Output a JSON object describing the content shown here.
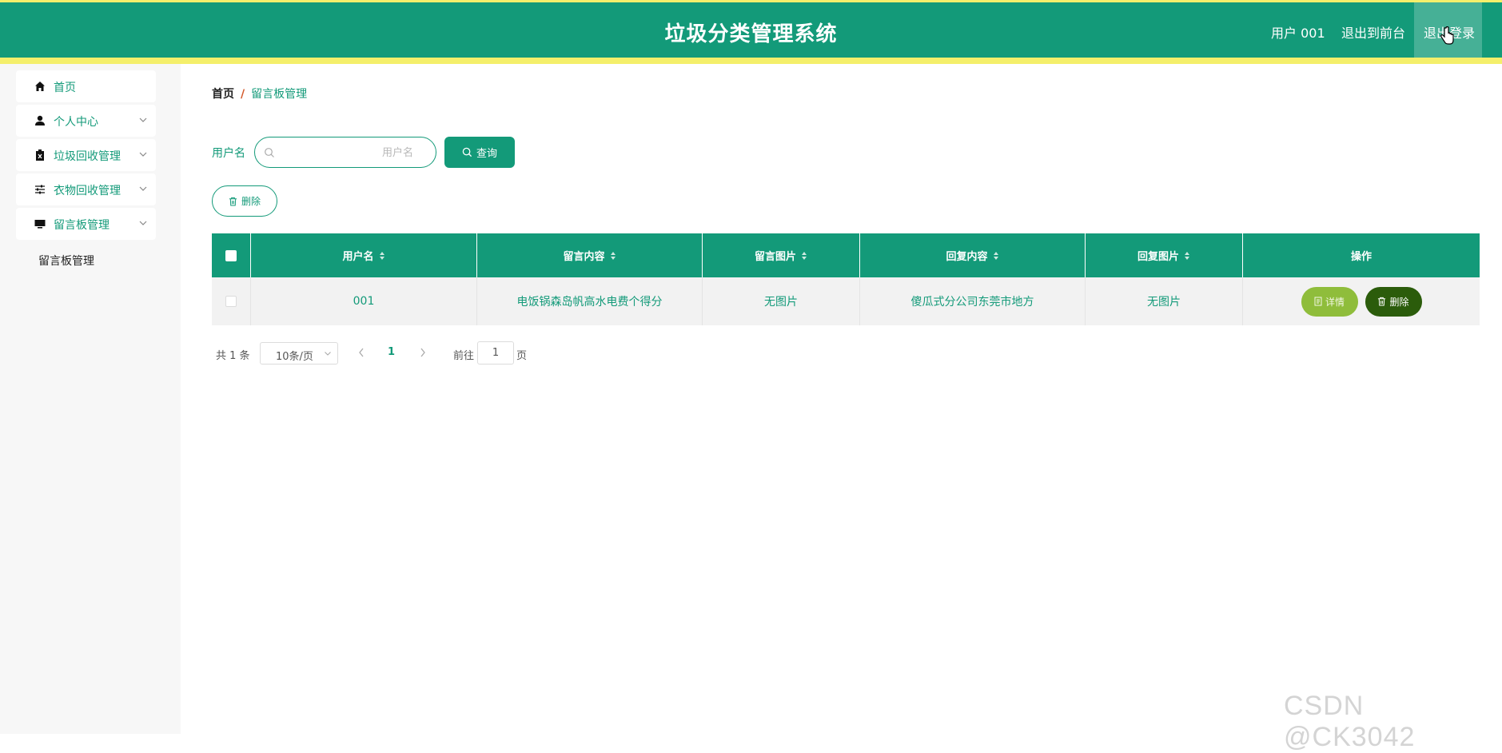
{
  "header": {
    "title": "垃圾分类管理系统",
    "user": "用户 001",
    "to_front": "退出到前台",
    "logout": "退出登录"
  },
  "sidebar": {
    "items": [
      {
        "label": "首页",
        "icon": "home-icon"
      },
      {
        "label": "个人中心",
        "icon": "user-icon"
      },
      {
        "label": "垃圾回收管理",
        "icon": "trash-icon"
      },
      {
        "label": "衣物回收管理",
        "icon": "sliders-icon"
      },
      {
        "label": "留言板管理",
        "icon": "monitor-icon"
      }
    ],
    "sub_item": "留言板管理"
  },
  "breadcrumb": {
    "home": "首页",
    "separator": "/",
    "current": "留言板管理"
  },
  "search": {
    "label": "用户名",
    "placeholder": "用户名",
    "value": "",
    "button": "查询"
  },
  "toolbar": {
    "delete_label": "删除"
  },
  "table": {
    "columns": [
      "用户名",
      "留言内容",
      "留言图片",
      "回复内容",
      "回复图片",
      "操作"
    ],
    "rows": [
      {
        "username": "001",
        "content": "电饭锅森岛帆高水电费个得分",
        "image": "无图片",
        "reply": "傻瓜式分公司东莞市地方",
        "reply_image": "无图片",
        "detail": "详情",
        "delete": "删除"
      }
    ]
  },
  "pagination": {
    "total": "共 1 条",
    "page_size": "10条/页",
    "current_page": "1",
    "goto_label": "前往",
    "goto_value": "1",
    "page_suffix": "页"
  },
  "watermark": "CSDN @CK3042",
  "colors": {
    "primary": "#139a79",
    "accent_stripe": "#f4ef6b",
    "detail_button": "#8fbd3b",
    "delete_button": "#2b5c0b"
  }
}
